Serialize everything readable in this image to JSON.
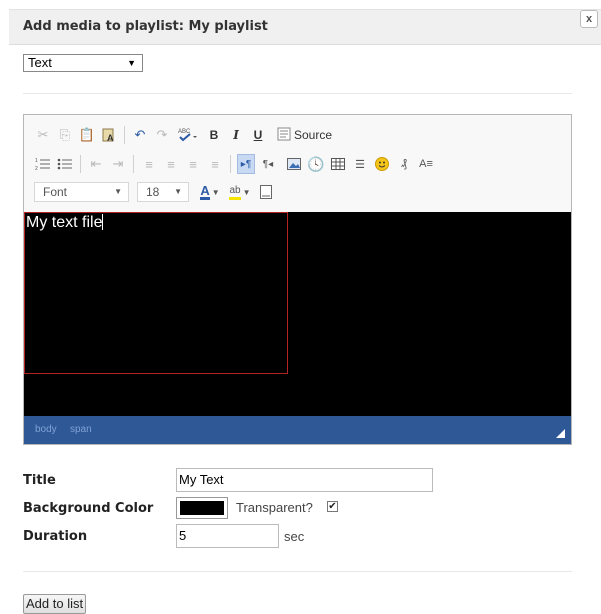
{
  "dialog": {
    "title": "Add media to playlist: My playlist",
    "close_label": "x"
  },
  "media_type": {
    "selected": "Text"
  },
  "editor": {
    "toolbar": {
      "source_label": "Source",
      "bold_label": "B",
      "italic_label": "I",
      "underline_label": "U",
      "font_combo": "Font",
      "size_combo": "18",
      "text_color_label": "A",
      "bg_color_label": "ab"
    },
    "content": {
      "text": "My text file",
      "background_color": "#000000",
      "text_color": "#ffffff"
    },
    "path": [
      "body",
      "span"
    ]
  },
  "form": {
    "title_label": "Title",
    "title_value": "My Text",
    "bg_color_label": "Background Color",
    "bg_color_value": "#000000",
    "transparent_label": "Transparent?",
    "transparent_checked": true,
    "duration_label": "Duration",
    "duration_value": "5",
    "duration_unit": "sec"
  },
  "actions": {
    "add_label": "Add to list"
  },
  "colors": {
    "statusbar": "#2f5896",
    "active_button": "#c7d9f3",
    "text_box_border": "#b22222"
  }
}
